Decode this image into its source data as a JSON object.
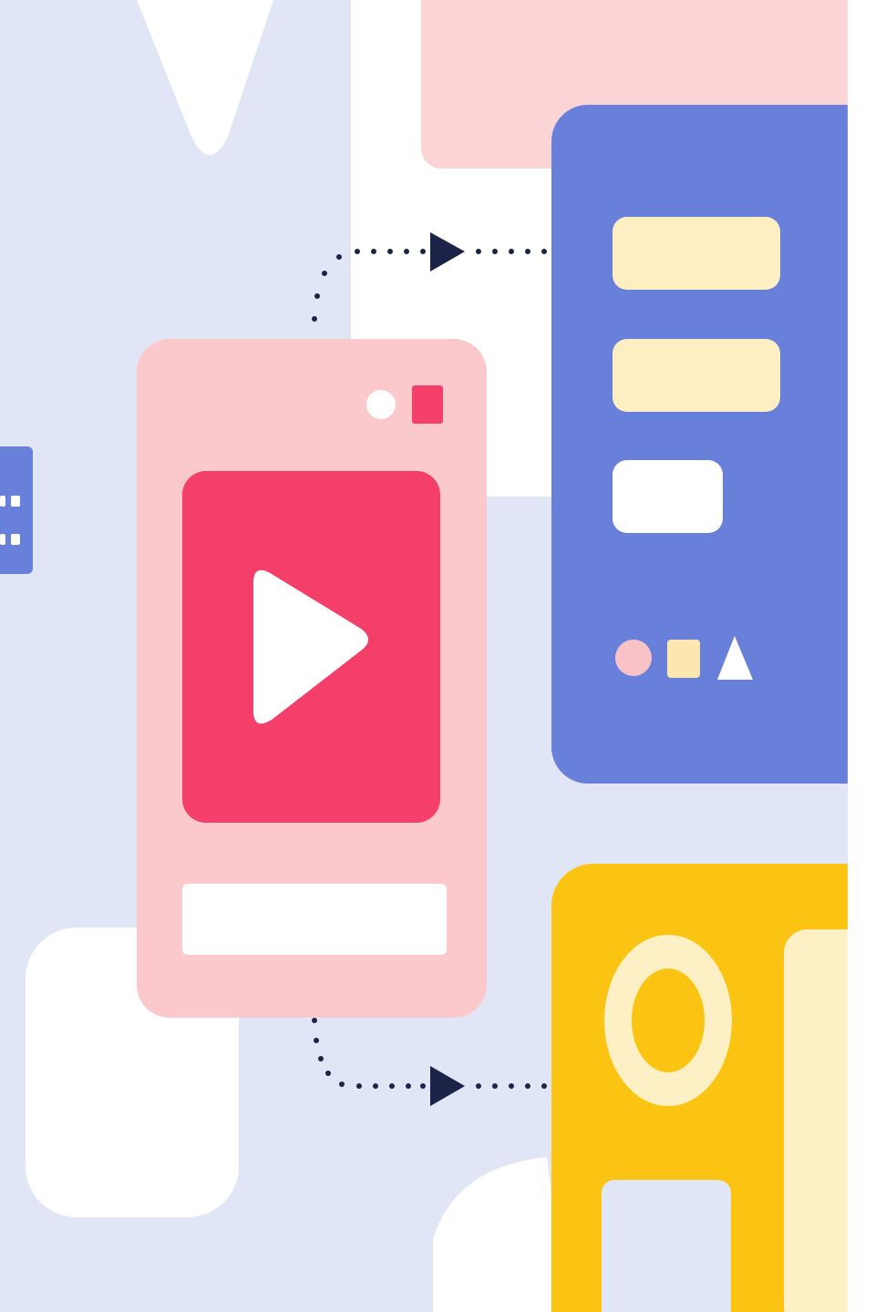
{
  "illustration": {
    "palette": {
      "background_lavender": "#E1E6F6",
      "white": "#FFFFFF",
      "pink_light": "#FDD4D6",
      "pink_card": "#FBC9CB",
      "video_red": "#F43F6B",
      "blue_card": "#6880DA",
      "cream": "#FDEFC2",
      "yellow": "#FBC312",
      "yellow_light": "#FEF0C5",
      "navy_arrow": "#1B2447",
      "dot_pink": "#F8C2C7",
      "dot_square": "#FCE7B0"
    },
    "icons": [
      "play-icon",
      "circle-shape-icon",
      "square-shape-icon",
      "triangle-shape-icon",
      "arrow-right-icon"
    ]
  }
}
